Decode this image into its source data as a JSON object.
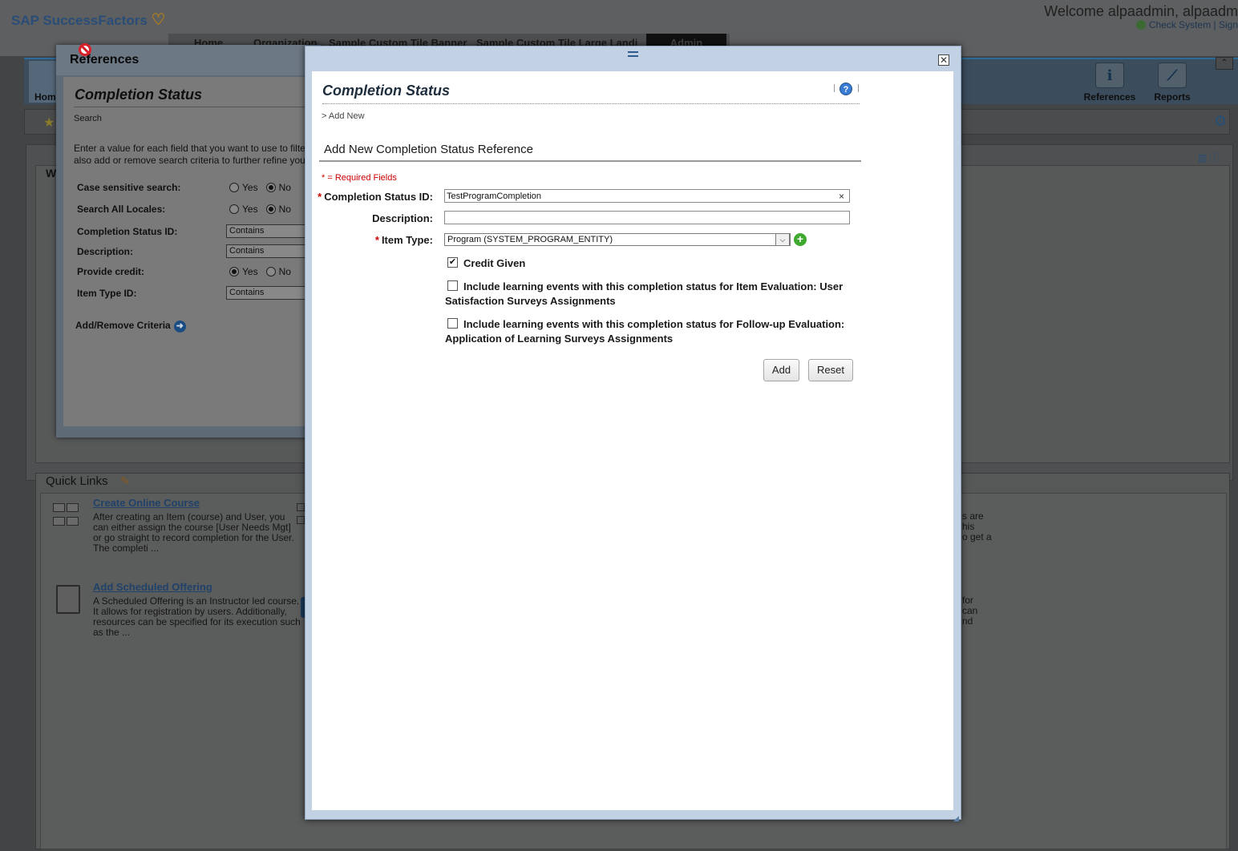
{
  "header": {
    "logo": "SAP SuccessFactors",
    "welcome": "Welcome alpaadmin, alpaadm",
    "links": "Check System |  Sign"
  },
  "nav": {
    "tabs": [
      "Home",
      "Organization",
      "Sample Custom Tile Banner",
      "Sample Custom Tile Large Landi"
    ],
    "active_tab": "Admin"
  },
  "tiles": {
    "home": "Hom",
    "references": "References",
    "reports": "Reports"
  },
  "workspace": {
    "partial_label": "W"
  },
  "quick_links": {
    "title": "Quick Links",
    "items": [
      {
        "title": "Create Online Course",
        "desc": "After creating an Item (course) and User, you can either assign the course [User Needs Mgt] or go straight to record completion for the User.  The completi ..."
      },
      {
        "title": "Add Scheduled Offering",
        "desc": "A Scheduled Offering is an Instructor led course.  It allows for registration by users.  Additionally, resources can be specified for its execution such as the ..."
      }
    ],
    "right_fragments_1": [
      "s are",
      "his",
      "o get a"
    ],
    "right_fragments_2": [
      "for",
      "can",
      "nd"
    ]
  },
  "references_window": {
    "title": "References",
    "section_title": "Completion Status",
    "subtitle": "Search",
    "intro": [
      "Enter a value for each field that you want to use to filter y",
      "also add or remove search criteria to further refine your s"
    ],
    "fields": [
      {
        "label": "Case sensitive search:",
        "type": "radio",
        "yes": "Yes",
        "no": "No",
        "selected": "No"
      },
      {
        "label": "Search All Locales:",
        "type": "radio",
        "yes": "Yes",
        "no": "No",
        "selected": "No"
      },
      {
        "label": "Completion Status ID:",
        "type": "select",
        "value": "Contains"
      },
      {
        "label": "Description:",
        "type": "select",
        "value": "Contains"
      },
      {
        "label": "Provide credit:",
        "type": "radio",
        "yes": "Yes",
        "no": "No",
        "selected": "Yes"
      },
      {
        "label": "Item Type ID:",
        "type": "select",
        "value": "Contains"
      }
    ],
    "add_remove": "Add/Remove Criteria"
  },
  "modal": {
    "title": "Completion Status",
    "breadcrumb": "> Add New",
    "form_title": "Add New Completion Status Reference",
    "required_note": "* = Required Fields",
    "fields": {
      "completion_status_id": {
        "label": "Completion Status ID:",
        "value": "TestProgramCompletion",
        "required": true
      },
      "description": {
        "label": "Description:",
        "value": ""
      },
      "item_type": {
        "label": "Item Type:",
        "value": "Program (SYSTEM_PROGRAM_ENTITY)",
        "required": true
      }
    },
    "checkboxes": [
      {
        "label": "Credit Given",
        "checked": true
      },
      {
        "label_line1": "Include learning events with this completion status for Item Evaluation: User",
        "label_line2": "Satisfaction Surveys Assignments",
        "checked": false
      },
      {
        "label_line1": "Include learning events with this completion status for Follow-up Evaluation:",
        "label_line2": "Application of Learning Surveys Assignments",
        "checked": false
      }
    ],
    "buttons": {
      "add": "Add",
      "reset": "Reset"
    }
  },
  "icons": {
    "help": "help-icon",
    "close": "close-icon",
    "add": "plus-circle-icon",
    "not_allowed": "no-entry-icon",
    "gear": "gear-icon"
  },
  "colors": {
    "required": "#cc0000",
    "modal_frame": "#c2d2e4",
    "add_icon": "#3fa82e",
    "help_icon": "#3a7bd5"
  }
}
